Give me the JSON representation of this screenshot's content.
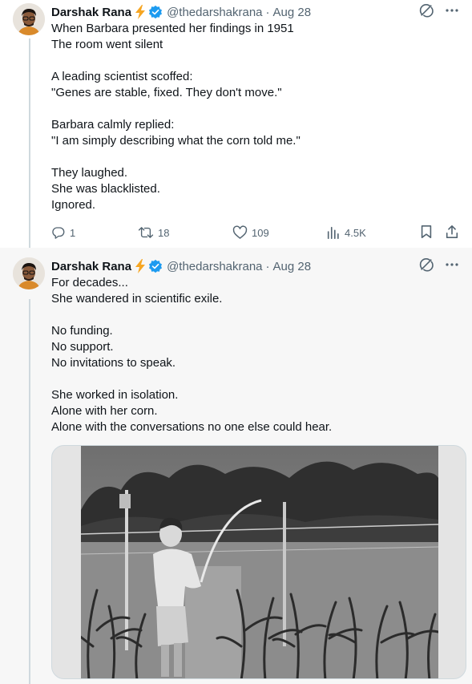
{
  "thread": [
    {
      "author": {
        "name": "Darshak Rana",
        "handle": "@thedarshakrana",
        "date": "Aug 28"
      },
      "text": "When Barbara presented her findings in 1951\nThe room went silent\n\nA leading scientist scoffed:\n\"Genes are stable, fixed. They don't move.\"\n\nBarbara calmly replied:\n\"I am simply describing what the corn told me.\"\n\nThey laughed.\nShe was blacklisted.\nIgnored.",
      "stats": {
        "replies": "1",
        "reposts": "18",
        "likes": "109",
        "views": "4.5K"
      }
    },
    {
      "author": {
        "name": "Darshak Rana",
        "handle": "@thedarshakrana",
        "date": "Aug 28"
      },
      "text": "For decades...\nShe wandered in scientific exile.\n\nNo funding.\nNo support.\nNo invitations to speak.\n\nShe worked in isolation.\nAlone with her corn.\nAlone with the conversations no one else could hear."
    }
  ],
  "icons": {
    "bolt": "lightning-bolt",
    "verified": "verified-badge",
    "grok": "grok-icon",
    "more": "more-icon",
    "reply": "reply-icon",
    "repost": "repost-icon",
    "like": "like-icon",
    "views": "views-icon",
    "bookmark": "bookmark-icon",
    "share": "share-icon"
  },
  "colors": {
    "accent": "#1d9bf0",
    "bolt": "#f6a623",
    "muted": "#536471",
    "text": "#0f1419"
  }
}
